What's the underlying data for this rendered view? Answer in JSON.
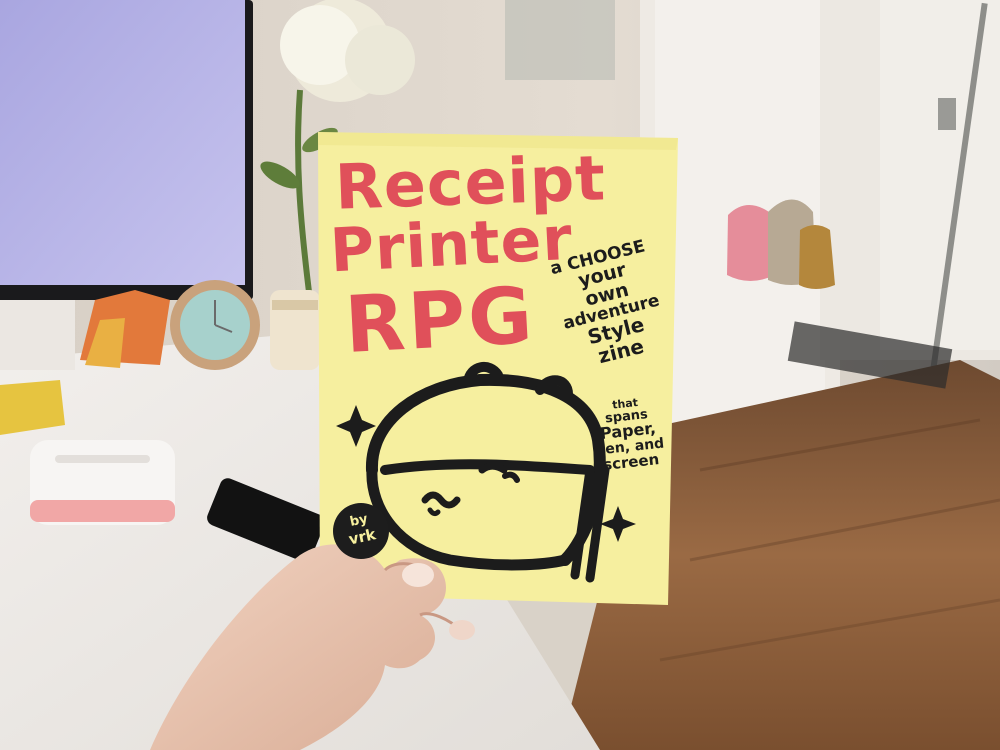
{
  "zine": {
    "title_line1": "Receipt",
    "title_line2": "Printer",
    "title_line3": "RPG",
    "tagline": [
      "a CHOOSE",
      "your",
      "own",
      "adventure",
      "Style",
      "zine"
    ],
    "subtagline": [
      "that",
      "spans",
      "Paper,",
      "Pen, and",
      "screen"
    ],
    "byline_label": "by",
    "byline_author": "vrk"
  },
  "colors": {
    "zine_paper": "#f6ef9f",
    "title_red": "#e0505a",
    "ink": "#1c1c1c",
    "floor_wood": "#8a5a36",
    "monitor_screen": "#b9b6e6"
  }
}
